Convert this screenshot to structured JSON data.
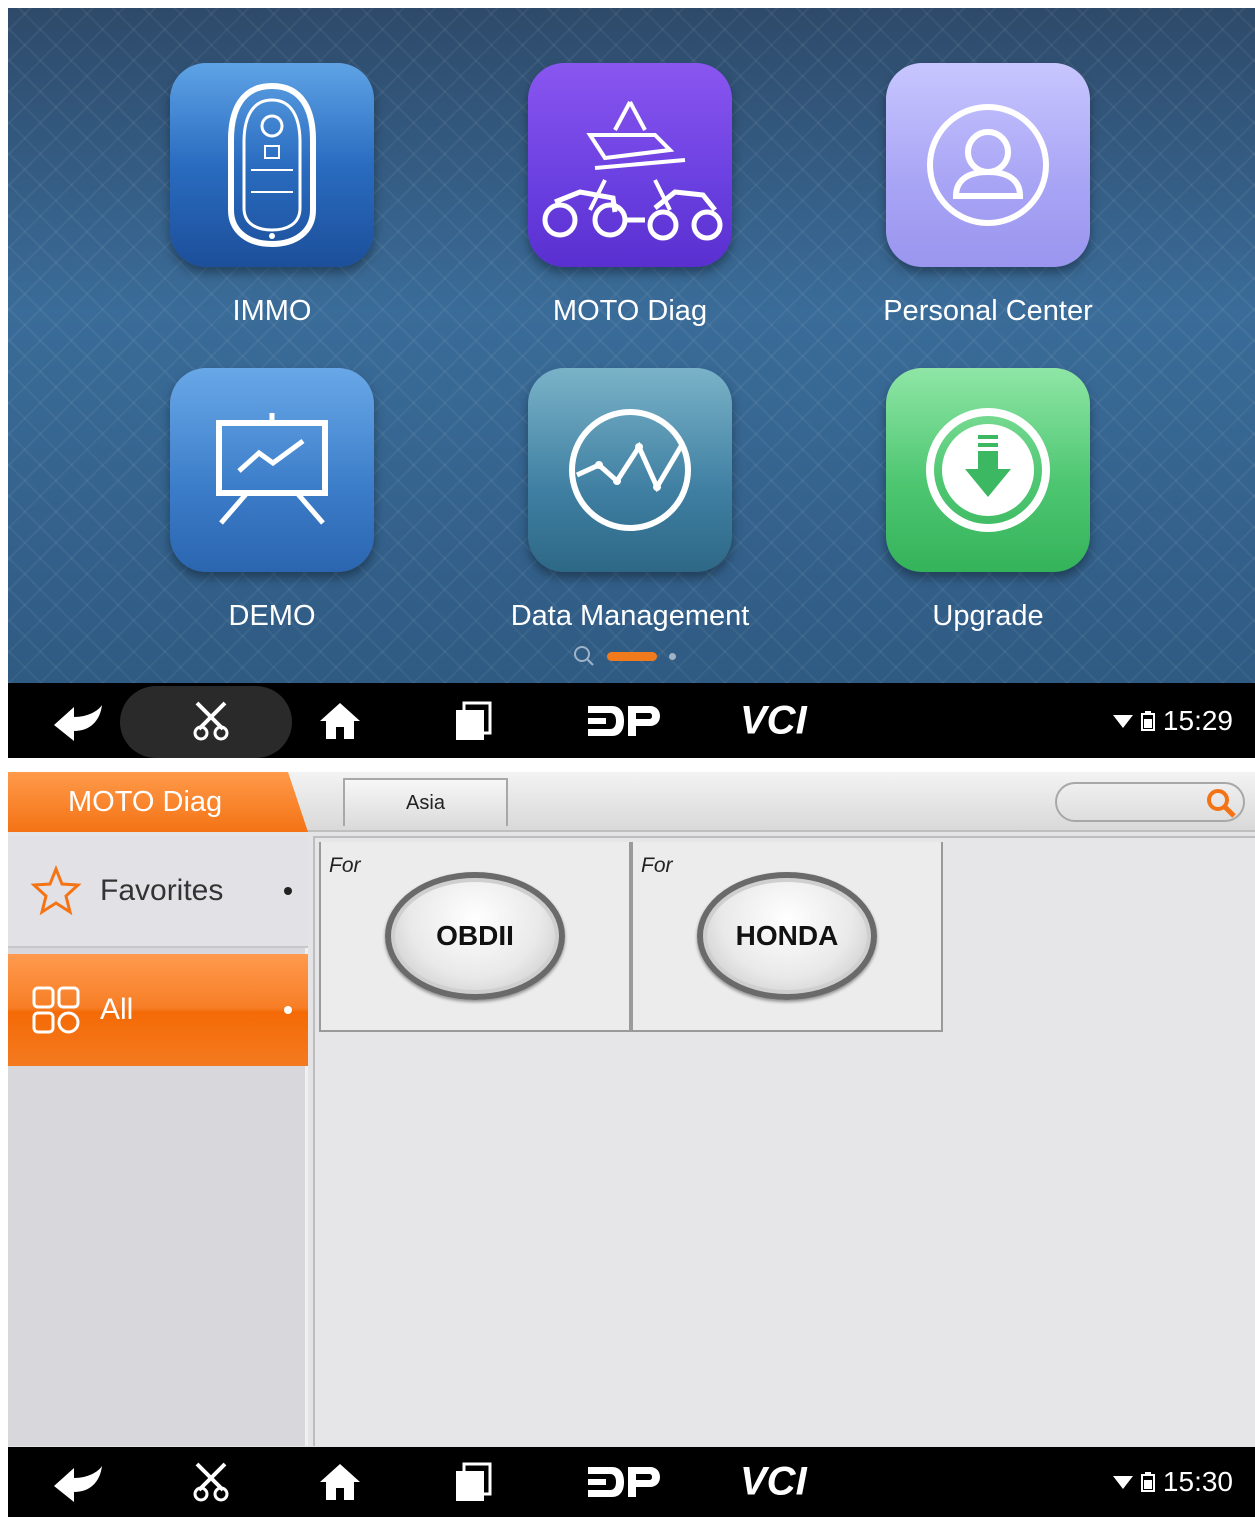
{
  "home": {
    "apps": [
      {
        "label": "IMMO",
        "icon": "key-fob-icon"
      },
      {
        "label": "MOTO Diag",
        "icon": "motorcycle-snowmobile-atv-icon"
      },
      {
        "label": "Personal Center",
        "icon": "user-profile-icon"
      },
      {
        "label": "DEMO",
        "icon": "presentation-board-icon"
      },
      {
        "label": "Data Management",
        "icon": "line-graph-icon"
      },
      {
        "label": "Upgrade",
        "icon": "download-arrow-icon"
      }
    ],
    "pager": {
      "active_page": 2,
      "total_pages": 3
    },
    "navbar": {
      "vci_label": "VCI",
      "time": "15:29"
    }
  },
  "moto_diag": {
    "title": "MOTO Diag",
    "region_tab": "Asia",
    "sidebar": [
      {
        "label": "Favorites",
        "icon": "star-icon",
        "selected": false
      },
      {
        "label": "All",
        "icon": "grid-icon",
        "selected": true
      }
    ],
    "brands": [
      {
        "for_label": "For",
        "name": "OBDII"
      },
      {
        "for_label": "For",
        "name": "HONDA"
      }
    ],
    "navbar": {
      "vci_label": "VCI",
      "time": "15:30"
    }
  },
  "colors": {
    "accent_orange": "#f47315",
    "nav_black": "#000000"
  }
}
